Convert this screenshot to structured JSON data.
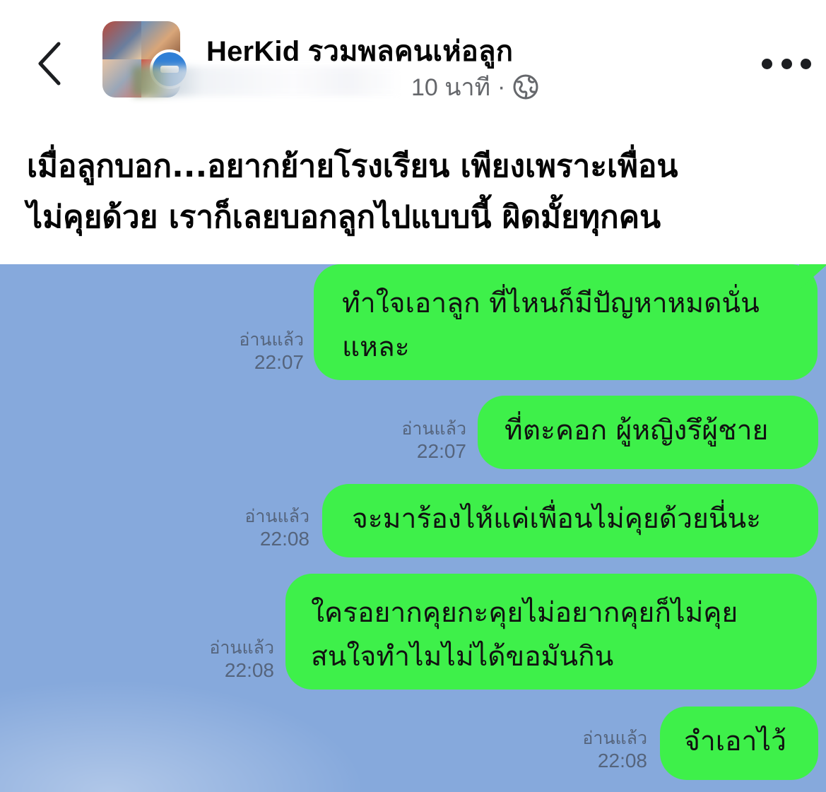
{
  "header": {
    "group_name": "HerKid รวมพลคนเห่อลูก",
    "time_ago": "10 นาที",
    "separator": "·"
  },
  "post": {
    "caption_line1": "เมื่อลูกบอก...อยากย้ายโรงเรียน เพียงเพราะเพื่อน",
    "caption_line2": "ไม่คุยด้วย เราก็เลยบอกลูกไปแบบนี้ ผิดมั้ยทุกคน"
  },
  "chat": {
    "messages": [
      {
        "text_line1": "ทำใจเอาลูก ที่ไหนก็มีปัญหาหมดนั่น",
        "text_line2": "แหละ",
        "read_label": "อ่านแล้ว",
        "time": "22:07"
      },
      {
        "text_line1": "ที่ตะคอก ผู้หญิงรึผู้ชาย",
        "read_label": "อ่านแล้ว",
        "time": "22:07"
      },
      {
        "text_line1": "จะมาร้องไห้แค่เพื่อนไม่คุยด้วยนี่นะ",
        "read_label": "อ่านแล้ว",
        "time": "22:08"
      },
      {
        "text_line1": "ใครอยากคุยกะคุยไม่อยากคุยก็ไม่คุย",
        "text_line2": "สนใจทำไมไม่ได้ขอมันกิน",
        "read_label": "อ่านแล้ว",
        "time": "22:08"
      },
      {
        "text_line1": "จำเอาไว้",
        "read_label": "อ่านแล้ว",
        "time": "22:08"
      }
    ],
    "bubble_color": "#3ef04a",
    "background_color": "#86a9dc"
  },
  "icons": {
    "back": "chevron-left-icon",
    "audience": "globe-icon",
    "more": "more-dots-icon"
  }
}
